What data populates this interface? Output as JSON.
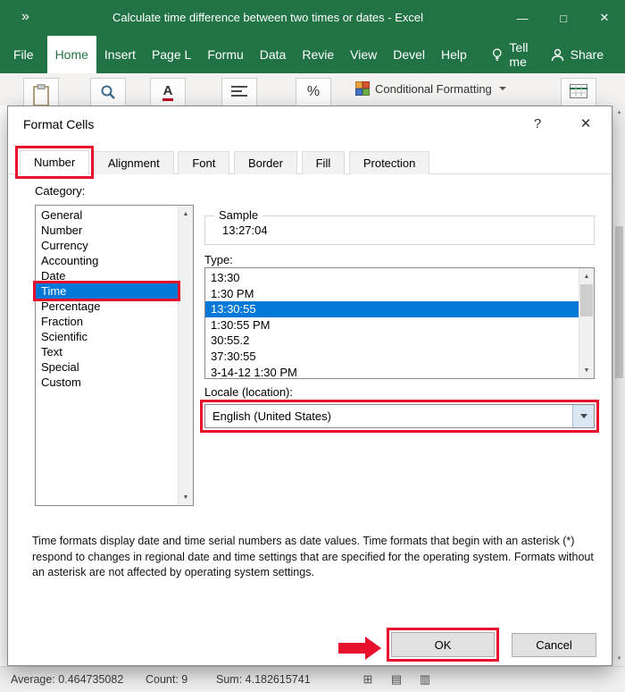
{
  "title_bar": {
    "title": "Calculate time difference between two times or dates  -  Excel"
  },
  "menu_bar": {
    "items": [
      "File",
      "Home",
      "Insert",
      "Page L",
      "Formu",
      "Data",
      "Revie",
      "View",
      "Devel",
      "Help"
    ],
    "tell_me": "Tell me",
    "share": "Share"
  },
  "ribbon": {
    "conditional_formatting_label": "Conditional Formatting"
  },
  "dialog": {
    "title": "Format Cells",
    "tabs": [
      "Number",
      "Alignment",
      "Font",
      "Border",
      "Fill",
      "Protection"
    ],
    "active_tab": "Number",
    "category": {
      "label": "Category:",
      "items": [
        "General",
        "Number",
        "Currency",
        "Accounting",
        "Date",
        "Time",
        "Percentage",
        "Fraction",
        "Scientific",
        "Text",
        "Special",
        "Custom"
      ],
      "selected": "Time"
    },
    "sample": {
      "label": "Sample",
      "value": "13:27:04"
    },
    "type": {
      "label": "Type:",
      "items": [
        "13:30",
        "1:30 PM",
        "13:30:55",
        "1:30:55 PM",
        "30:55.2",
        "37:30:55",
        "3-14-12 1:30 PM"
      ],
      "selected": "13:30:55"
    },
    "locale": {
      "label": "Locale (location):",
      "value": "English (United States)"
    },
    "description": "Time formats display date and time serial numbers as date values.  Time formats that begin with an asterisk (*) respond to changes in regional date and time settings that are specified for the operating system. Formats without an asterisk are not affected by operating system settings.",
    "buttons": {
      "ok": "OK",
      "cancel": "Cancel"
    }
  },
  "status_bar": {
    "average": "Average: 0.464735082",
    "count": "Count: 9",
    "sum": "Sum: 4.182615741"
  },
  "icons": {
    "chevrons": "»",
    "minimize": "—",
    "maximize": "□",
    "close": "✕",
    "help": "?",
    "scroll_up": "▲",
    "scroll_down": "▼",
    "view_normal": "⊞",
    "view_page_layout": "▤",
    "view_page_break": "▥"
  },
  "colors": {
    "excel_green": "#217346",
    "selection_blue": "#0078d7",
    "annotation_red": "#e8112d"
  }
}
